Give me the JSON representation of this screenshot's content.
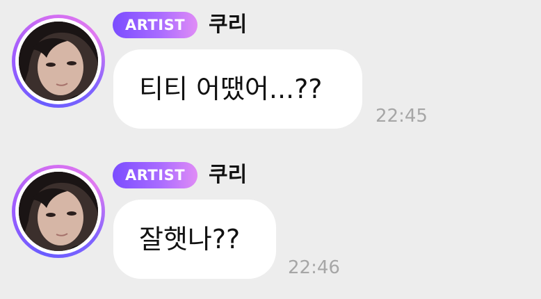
{
  "messages": [
    {
      "badge": "ARTIST",
      "sender": "쿠리",
      "text": "티티 어땠어...??",
      "time": "22:45"
    },
    {
      "badge": "ARTIST",
      "sender": "쿠리",
      "text": "잘햇나??",
      "time": "22:46"
    }
  ],
  "colors": {
    "background": "#ededed",
    "bubble": "#ffffff",
    "badge_gradient_start": "#7b4dff",
    "badge_gradient_end": "#e08cf6",
    "timestamp": "#a6a6a6"
  },
  "icons": {
    "avatar": "artist-profile-photo"
  }
}
